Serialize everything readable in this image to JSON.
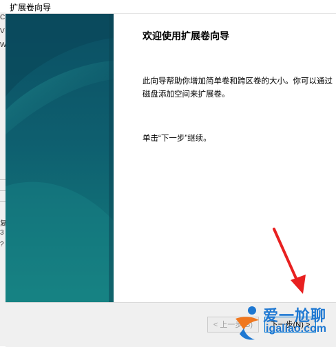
{
  "window": {
    "title": "扩展卷向导"
  },
  "background_window": {
    "glyphs": [
      "C",
      "V",
      "W",
      "复",
      "3",
      "?"
    ]
  },
  "wizard": {
    "heading": "欢迎使用扩展卷向导",
    "description_line1": "此向导帮助你增加简单卷和跨区卷的大小。你可以通过",
    "description_line2": "磁盘添加空间来扩展卷。",
    "continue_hint": "单击“下一步”继续。"
  },
  "buttons": {
    "back": "< 上一步(B)",
    "next": "下一步(N) >"
  },
  "watermark": {
    "text_cn": "爱一尬聊",
    "text_url": "igaliao.com"
  },
  "colors": {
    "banner_dark": "#0b4f63",
    "banner_light": "#1a8a8c",
    "annotation_arrow": "#e82020",
    "watermark_blue": "#1e78d2",
    "watermark_orange": "#f07820"
  }
}
